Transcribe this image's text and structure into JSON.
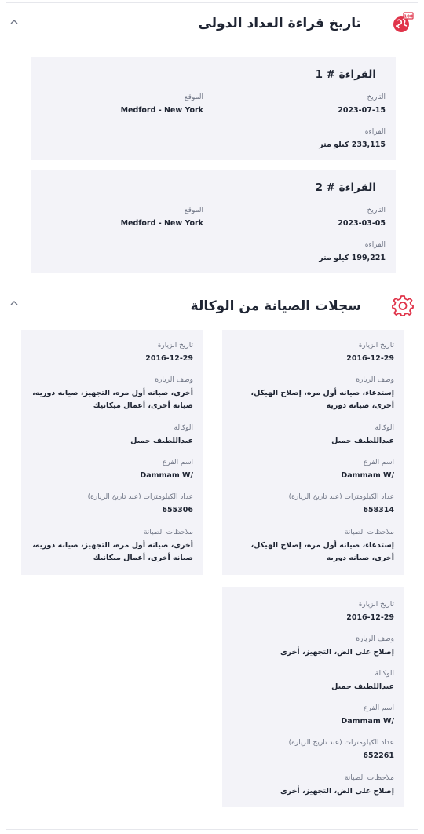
{
  "odometer": {
    "title": "تاريخ قراءة العداد الدولى",
    "icon": "odometer-globe-icon",
    "accent": "#e0344a",
    "icon_badge": "100",
    "readings": [
      {
        "title": "القراءة # 1",
        "date_label": "التاريخ",
        "date": "2023-07-15",
        "location_label": "الموقع",
        "location": "Medford - New York",
        "reading_label": "القراءة",
        "reading": "233,115 كيلو متر"
      },
      {
        "title": "القراءة # 2",
        "date_label": "التاريخ",
        "date": "2023-03-05",
        "location_label": "الموقع",
        "location": "Medford - New York",
        "reading_label": "القراءة",
        "reading": "199,221 كيلو متر"
      }
    ]
  },
  "maintenance": {
    "title": "سجلات الصيانة من الوكالة",
    "icon": "gear-icon",
    "records": [
      {
        "visit_date_label": "تاريخ الزيارة",
        "visit_date": "2016-12-29",
        "visit_desc_label": "وصف الزيارة",
        "visit_desc": "إستدعاء، صيانه أول مره، إصلاح الهيكل، أخرى، صيانه دوريه",
        "agency_label": "الوكالة",
        "agency": "عبداللطيف جميل",
        "branch_label": "اسم الفرع",
        "branch": "Dammam W/",
        "km_label": "عداد الكيلومترات (عند تاريخ الزيارة)",
        "km": "658314",
        "notes_label": "ملاحظات الصيانة",
        "notes": "إستدعاء، صيانه أول مره، إصلاح الهيكل، أخرى، صيانه دوريه"
      },
      {
        "visit_date_label": "تاريخ الزيارة",
        "visit_date": "2016-12-29",
        "visit_desc_label": "وصف الزيارة",
        "visit_desc": "أخرى، صيانه أول مره، التجهيز، صيانه دوريه، صيانه أخرى، أعمال ميكانيك",
        "agency_label": "الوكالة",
        "agency": "عبداللطيف جميل",
        "branch_label": "اسم الفرع",
        "branch": "Dammam W/",
        "km_label": "عداد الكيلومترات (عند تاريخ الزيارة)",
        "km": "655306",
        "notes_label": "ملاحظات الصيانة",
        "notes": "أخرى، صيانه أول مره، التجهيز، صيانه دوريه، صيانه أخرى، أعمال ميكانيك"
      },
      {
        "visit_date_label": "تاريخ الزيارة",
        "visit_date": "2016-12-29",
        "visit_desc_label": "وصف الزيارة",
        "visit_desc": "إصلاح على الض، التجهيز، أخرى",
        "agency_label": "الوكالة",
        "agency": "عبداللطيف جميل",
        "branch_label": "اسم الفرع",
        "branch": "Dammam W/",
        "km_label": "عداد الكيلومترات (عند تاريخ الزيارة)",
        "km": "652261",
        "notes_label": "ملاحظات الصيانة",
        "notes": "إصلاح على الض، التجهيز، أخرى"
      }
    ]
  }
}
